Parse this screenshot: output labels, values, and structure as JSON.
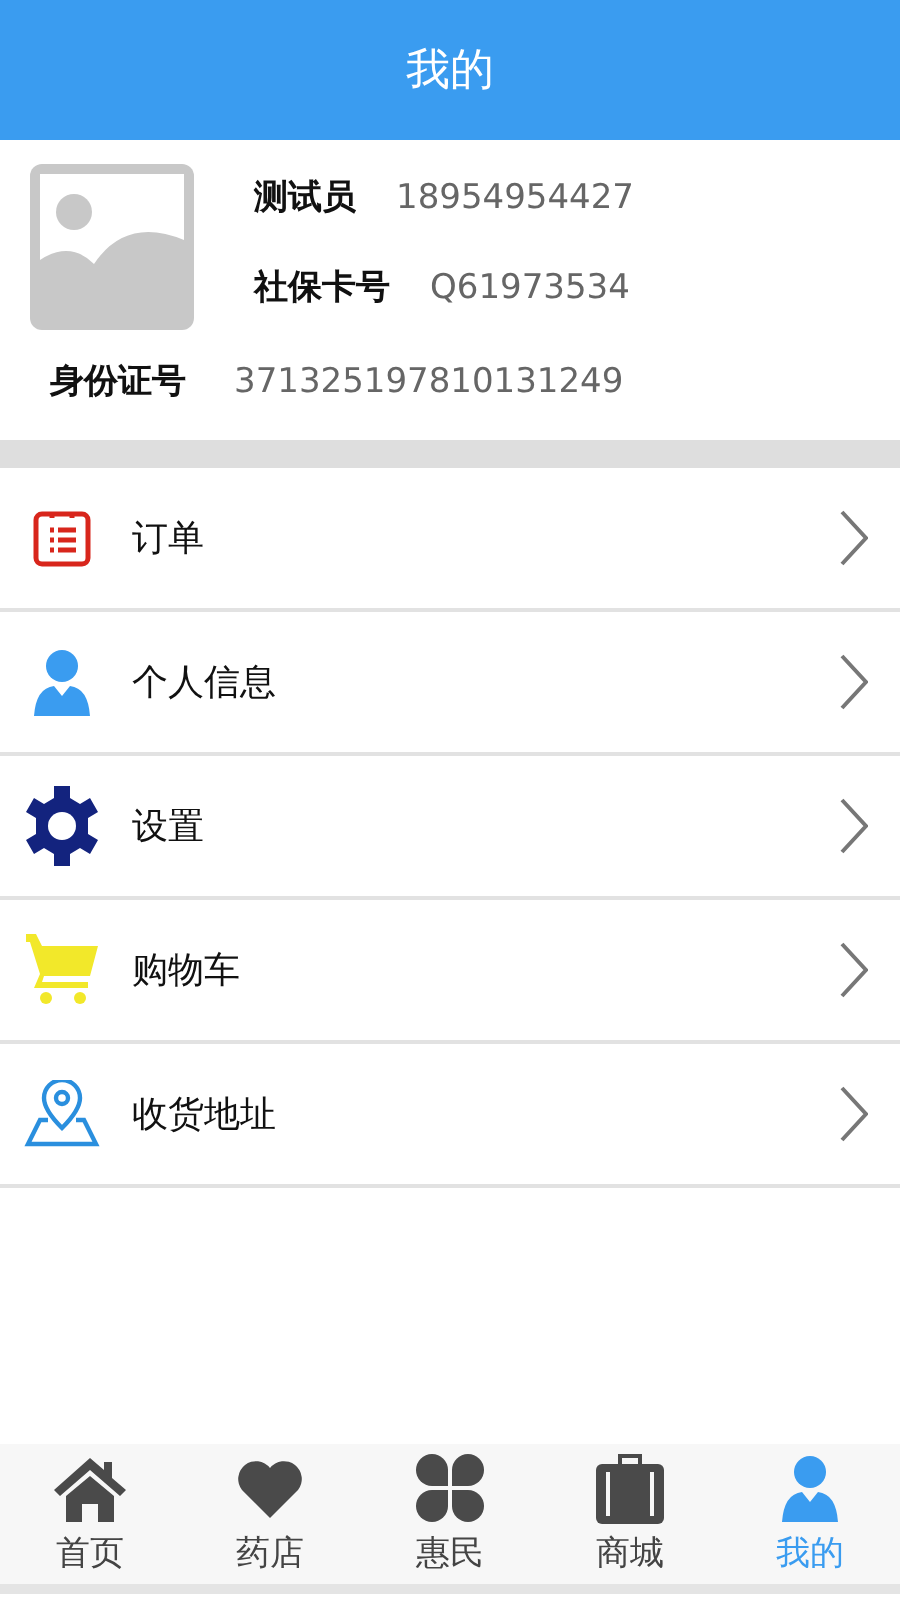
{
  "header": {
    "title": "我的"
  },
  "profile": {
    "name_label": "测试员",
    "phone": "18954954427",
    "card_label": "社保卡号",
    "card_number": "Q61973534",
    "id_label": "身份证号",
    "id_number": "371325197810131249"
  },
  "menu": [
    {
      "kind": "order",
      "label": "订单"
    },
    {
      "kind": "person",
      "label": "个人信息"
    },
    {
      "kind": "gear",
      "label": "设置"
    },
    {
      "kind": "cart",
      "label": "购物车"
    },
    {
      "kind": "location",
      "label": "收货地址"
    }
  ],
  "tabbar": [
    {
      "kind": "home",
      "label": "首页",
      "selected": false
    },
    {
      "kind": "heart",
      "label": "药店",
      "selected": false
    },
    {
      "kind": "clover",
      "label": "惠民",
      "selected": false
    },
    {
      "kind": "bag",
      "label": "商城",
      "selected": false
    },
    {
      "kind": "person",
      "label": "我的",
      "selected": true
    }
  ]
}
